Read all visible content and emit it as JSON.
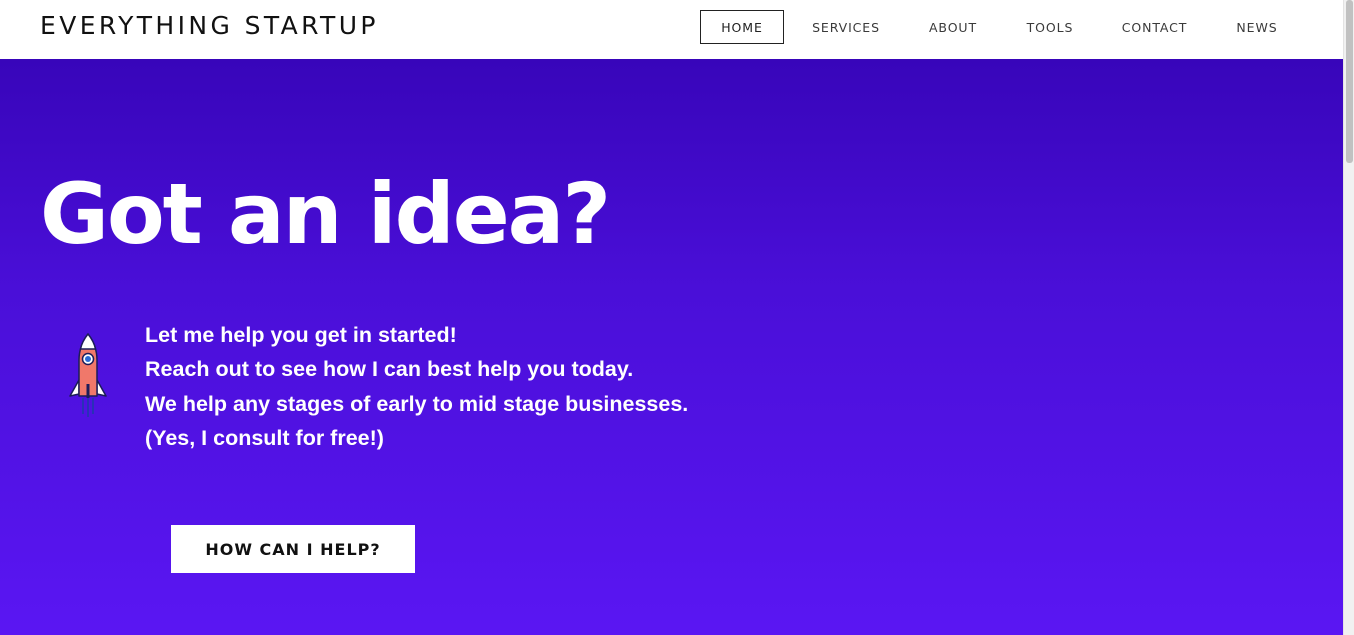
{
  "header": {
    "brand": "EVERYTHING STARTUP",
    "nav": [
      {
        "label": "HOME",
        "active": true
      },
      {
        "label": "SERVICES",
        "active": false
      },
      {
        "label": "ABOUT",
        "active": false
      },
      {
        "label": "TOOLS",
        "active": false
      },
      {
        "label": "CONTACT",
        "active": false
      },
      {
        "label": "NEWS",
        "active": false
      }
    ]
  },
  "hero": {
    "title": "Got an idea?",
    "lines": [
      "Let me help you get in started!",
      "Reach out to see how I can best help you today.",
      "We help any stages of early to mid stage businesses.",
      "(Yes, I consult for free!)"
    ],
    "cta_label": "HOW CAN I HELP?",
    "icon": "rocket-icon"
  },
  "colors": {
    "hero_top": "#3805ba",
    "hero_bottom": "#5a16f3",
    "header_bg": "#ffffff",
    "rocket_body": "#f0786a"
  }
}
